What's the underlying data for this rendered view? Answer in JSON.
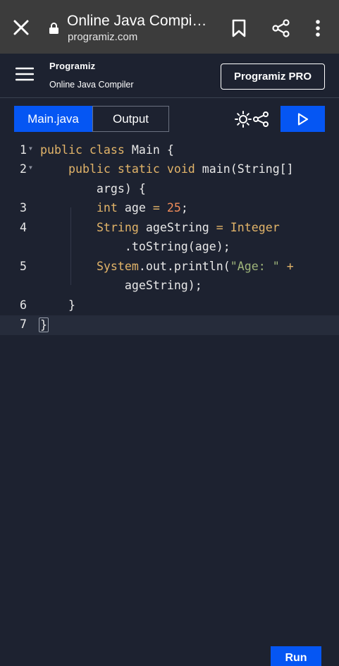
{
  "browser": {
    "tab_title": "Online Java Compi…",
    "url": "programiz.com"
  },
  "header": {
    "logo_text": "Programiz",
    "subtitle": "Online Java Compiler",
    "pro_button": "Programiz PRO"
  },
  "tabs": {
    "main": "Main.java",
    "output": "Output"
  },
  "editor": {
    "line_numbers": [
      "1",
      "2",
      "3",
      "4",
      "5",
      "6",
      "7"
    ]
  },
  "run_button": "Run",
  "colors": {
    "accent": "#0556f3",
    "background": "#1d2230",
    "browser_bar": "#3c3c3c",
    "keyword": "#e2b469",
    "number": "#f08c5a",
    "string": "#9fb57a"
  }
}
